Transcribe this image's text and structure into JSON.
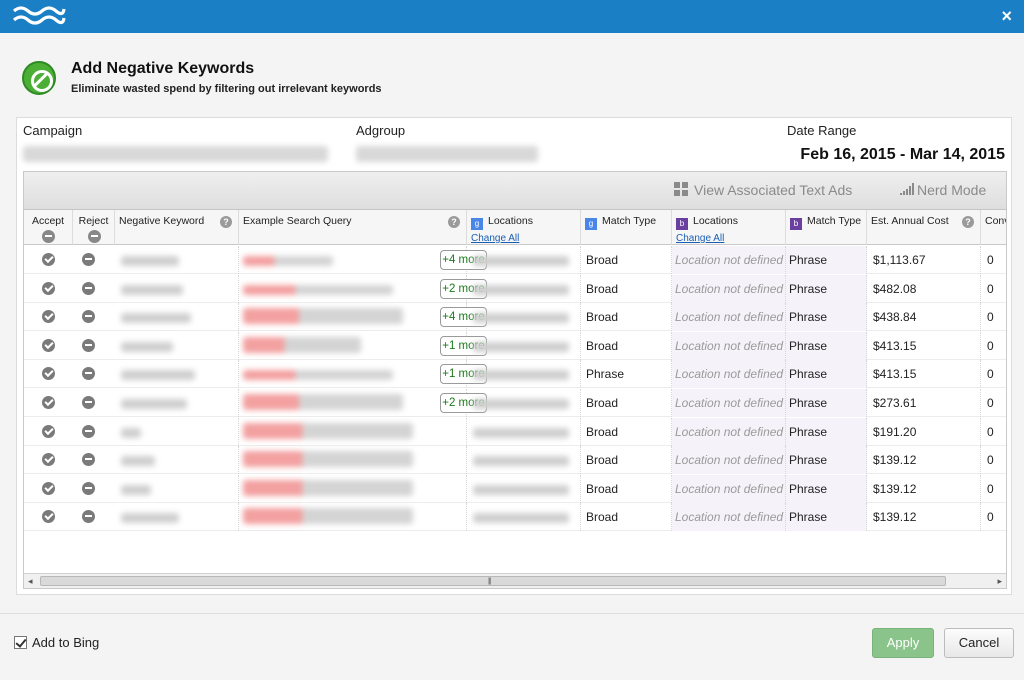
{
  "window": {
    "close_label": "×"
  },
  "header": {
    "title": "Add Negative Keywords",
    "subtitle": "Eliminate wasted spend by filtering out irrelevant keywords"
  },
  "meta": {
    "campaign_label": "Campaign",
    "adgroup_label": "Adgroup",
    "date_range_label": "Date Range",
    "date_range_value": "Feb 16, 2015 - Mar 14, 2015"
  },
  "toolbar": {
    "view_ads_label": "View Associated Text Ads",
    "nerd_mode_label": "Nerd Mode"
  },
  "columns": {
    "accept": "Accept",
    "reject": "Reject",
    "negative_keyword": "Negative Keyword",
    "example_query": "Example Search Query",
    "g_locations": "Locations",
    "g_change_all": "Change All",
    "g_match_type": "Match Type",
    "b_locations": "Locations",
    "b_change_all": "Change All",
    "b_match_type": "Match Type",
    "est_annual_cost": "Est. Annual Cost",
    "conv": "Conv"
  },
  "badges": {
    "google": "g",
    "bing": "b"
  },
  "rows": [
    {
      "more": "+4 more",
      "g_match": "Broad",
      "b_location": "Location not defined",
      "b_match": "Phrase",
      "cost": "$1,113.67",
      "conv": "0"
    },
    {
      "more": "+2 more",
      "g_match": "Broad",
      "b_location": "Location not defined",
      "b_match": "Phrase",
      "cost": "$482.08",
      "conv": "0"
    },
    {
      "more": "+4 more",
      "g_match": "Broad",
      "b_location": "Location not defined",
      "b_match": "Phrase",
      "cost": "$438.84",
      "conv": "0"
    },
    {
      "more": "+1 more",
      "g_match": "Broad",
      "b_location": "Location not defined",
      "b_match": "Phrase",
      "cost": "$413.15",
      "conv": "0"
    },
    {
      "more": "+1 more",
      "g_match": "Phrase",
      "b_location": "Location not defined",
      "b_match": "Phrase",
      "cost": "$413.15",
      "conv": "0"
    },
    {
      "more": "+2 more",
      "g_match": "Broad",
      "b_location": "Location not defined",
      "b_match": "Phrase",
      "cost": "$273.61",
      "conv": "0"
    },
    {
      "more": "",
      "g_match": "Broad",
      "b_location": "Location not defined",
      "b_match": "Phrase",
      "cost": "$191.20",
      "conv": "0"
    },
    {
      "more": "",
      "g_match": "Broad",
      "b_location": "Location not defined",
      "b_match": "Phrase",
      "cost": "$139.12",
      "conv": "0"
    },
    {
      "more": "",
      "g_match": "Broad",
      "b_location": "Location not defined",
      "b_match": "Phrase",
      "cost": "$139.12",
      "conv": "0"
    },
    {
      "more": "",
      "g_match": "Broad",
      "b_location": "Location not defined",
      "b_match": "Phrase",
      "cost": "$139.12",
      "conv": "0"
    }
  ],
  "scrollbar": {
    "left_arrow": "◂",
    "right_arrow": "▸",
    "grip": "|||"
  },
  "footer": {
    "add_to_bing_label": "Add to Bing",
    "add_to_bing_checked": true,
    "apply_label": "Apply",
    "cancel_label": "Cancel"
  },
  "colors": {
    "titlebar": "#1a7fc4",
    "apply_button": "#8bc48b",
    "more_text": "#1a7a1a",
    "link": "#1a5fb4"
  }
}
